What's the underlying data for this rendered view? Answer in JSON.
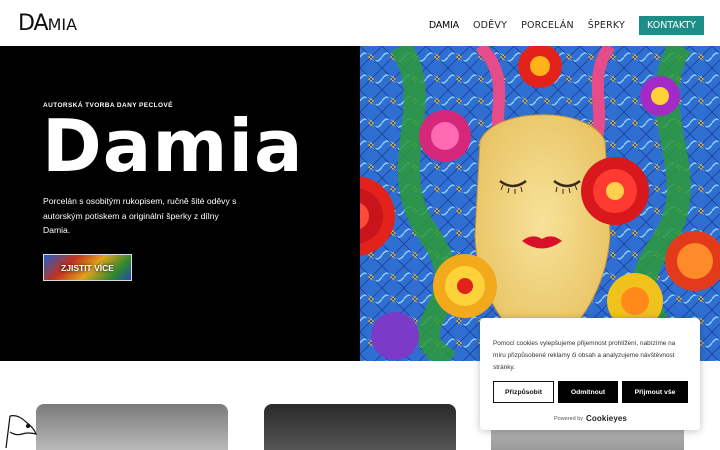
{
  "header": {
    "logo": {
      "main": "DA",
      "small": "MIA"
    },
    "nav": [
      {
        "label": "Damia",
        "active": true
      },
      {
        "label": "Oděvy",
        "active": false
      },
      {
        "label": "Porcelán",
        "active": false
      },
      {
        "label": "Šperky",
        "active": false
      }
    ],
    "cta_label": "Kontakty"
  },
  "hero": {
    "eyebrow": "Autorská tvorba Dany Peclové",
    "title": "Damia",
    "description": "Porcelán s osobitým rukopisem, ručně šité oděvy s autorským potiskem a originální šperky z dílny Damia.",
    "button_label": "Zjistit více"
  },
  "cookie": {
    "text": "Pomocí cookies vylepšujeme přijemnost prohlížení, nabízíme na míru přizpůsobené reklamy či obsah a analyzujeme návštěvnost stránky.",
    "customize_label": "Přizpůsobit",
    "reject_label": "Odmítnout",
    "accept_label": "Přijmout vše",
    "powered_by": "Powered by",
    "brand": "Cookieyes"
  },
  "colors": {
    "accent": "#1d8d88",
    "hero_bg": "#000000"
  },
  "icons": [
    "bird-decoration-icon"
  ]
}
